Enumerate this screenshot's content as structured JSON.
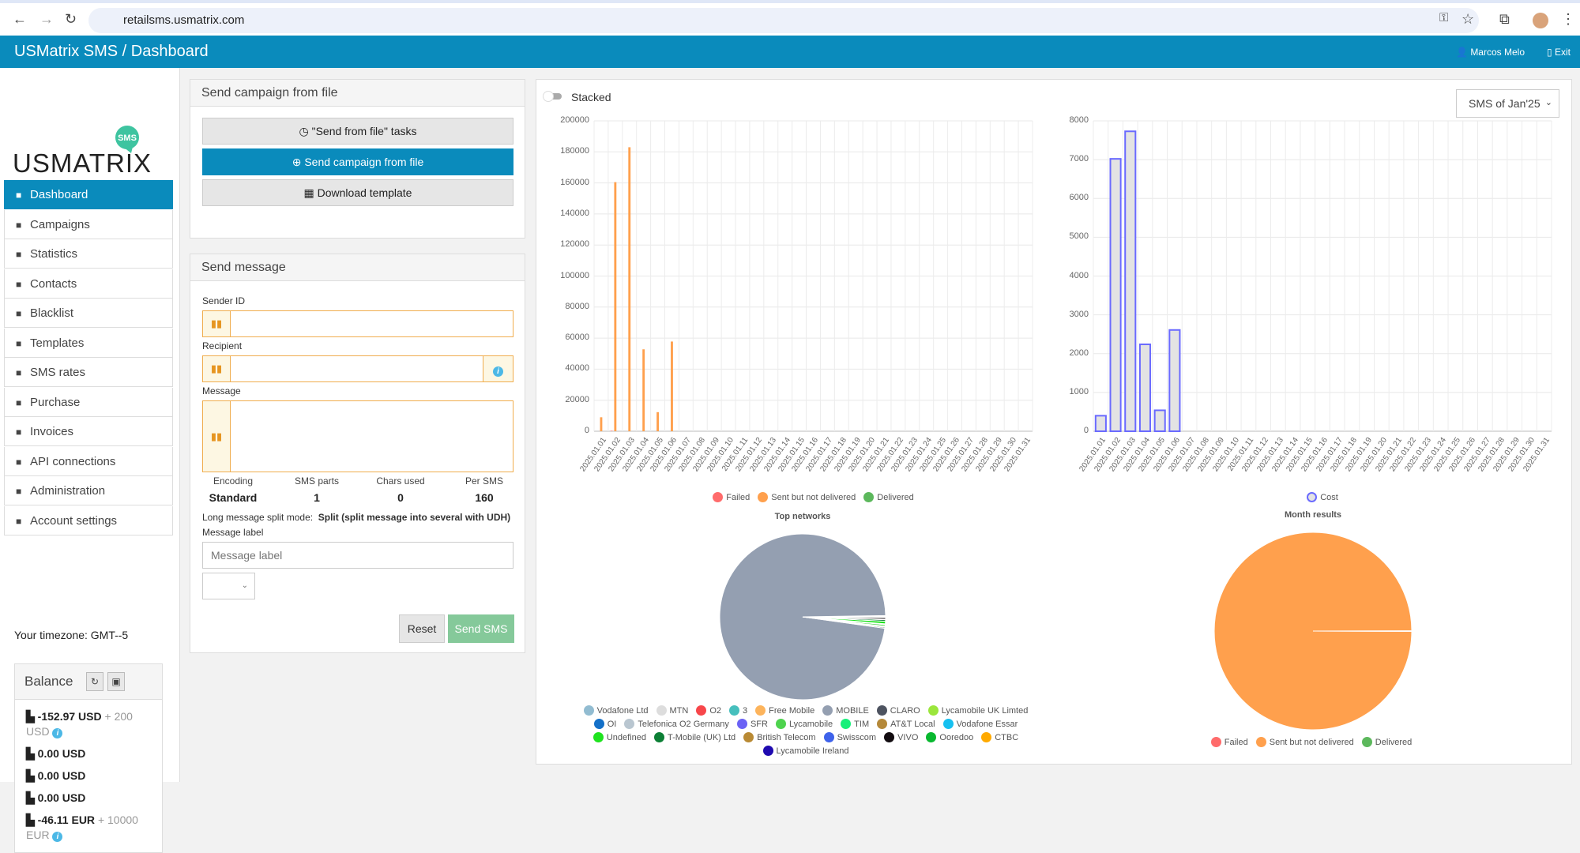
{
  "browser": {
    "url": "retailsms.usmatrix.com"
  },
  "header": {
    "title": "USMatrix SMS / Dashboard",
    "user": "Marcos Melo",
    "exit": "Exit"
  },
  "logo": {
    "text": "USMATRIX",
    "badge": "SMS"
  },
  "sidebar": {
    "items": [
      {
        "label": "Dashboard",
        "icon": "dashboard-icon",
        "active": true
      },
      {
        "label": "Campaigns",
        "icon": "comments-icon"
      },
      {
        "label": "Statistics",
        "icon": "report-icon"
      },
      {
        "label": "Contacts",
        "icon": "address-book-icon"
      },
      {
        "label": "Blacklist",
        "icon": "blacklist-icon"
      },
      {
        "label": "Templates",
        "icon": "file-icon"
      },
      {
        "label": "SMS rates",
        "icon": "rates-icon"
      },
      {
        "label": "Purchase",
        "icon": "cart-icon"
      },
      {
        "label": "Invoices",
        "icon": "invoice-icon"
      },
      {
        "label": "API connections",
        "icon": "plug-icon"
      },
      {
        "label": "Administration",
        "icon": "building-icon"
      },
      {
        "label": "Account settings",
        "icon": "gear-icon"
      }
    ],
    "timezone": "Your timezone: GMT--5"
  },
  "balance": {
    "title": "Balance",
    "rows": [
      {
        "amount": "-152.97 USD",
        "extra": "+ 200 USD",
        "info": true
      },
      {
        "amount": "0.00 USD"
      },
      {
        "amount": "0.00 USD"
      },
      {
        "amount": "0.00 USD"
      },
      {
        "amount": "-46.11 EUR",
        "extra": "+ 10000 EUR",
        "info": true
      }
    ]
  },
  "campaign_panel": {
    "title": "Send campaign from file",
    "tasks": "\"Send from file\" tasks",
    "send": "Send campaign from file",
    "download": "Download template"
  },
  "send_panel": {
    "title": "Send message",
    "sender_label": "Sender ID",
    "sender_value": "",
    "recipient_label": "Recipient",
    "recipient_value": "",
    "message_label": "Message",
    "message_value": "",
    "stats": [
      {
        "label": "Encoding",
        "value": "Standard"
      },
      {
        "label": "SMS parts",
        "value": "1"
      },
      {
        "label": "Chars used",
        "value": "0"
      },
      {
        "label": "Per SMS",
        "value": "160"
      }
    ],
    "split_label": "Long message split mode:",
    "split_value": "Split (split message into several with UDH)",
    "msglabel_label": "Message label",
    "msglabel_placeholder": "Message label",
    "select_value": "",
    "reset": "Reset",
    "send": "Send SMS"
  },
  "dashboard": {
    "stacked_label": "Stacked",
    "stacked": false,
    "period": "SMS of Jan'25"
  },
  "colors": {
    "brand": "#0a8bbc",
    "failed": "#ff6b6b",
    "sent": "#ffa04d",
    "delivered": "#5cb85c",
    "cost_border": "#6a6aff",
    "cost_fill": "#e3e3e3",
    "send_sms": "#85c99a"
  },
  "chart_data": [
    {
      "type": "bar",
      "ylim": [
        0,
        200000
      ],
      "yticks": [
        "0",
        "20000",
        "40000",
        "60000",
        "80000",
        "100000",
        "120000",
        "140000",
        "160000",
        "180000",
        "200000"
      ],
      "categories": [
        "2025.01.01",
        "2025.01.02",
        "2025.01.03",
        "2025.01.04",
        "2025.01.05",
        "2025.01.06",
        "2025.01.07",
        "2025.01.08",
        "2025.01.09",
        "2025.01.10",
        "2025.01.11",
        "2025.01.12",
        "2025.01.13",
        "2025.01.14",
        "2025.01.15",
        "2025.01.16",
        "2025.01.17",
        "2025.01.18",
        "2025.01.19",
        "2025.01.20",
        "2025.01.21",
        "2025.01.22",
        "2025.01.23",
        "2025.01.24",
        "2025.01.25",
        "2025.01.26",
        "2025.01.27",
        "2025.01.28",
        "2025.01.29",
        "2025.01.30",
        "2025.01.31"
      ],
      "series": [
        {
          "name": "Failed",
          "color": "#ff6b6b",
          "values": [
            0,
            300,
            0,
            0,
            0,
            0,
            0,
            0,
            0,
            0,
            0,
            0,
            0,
            0,
            0,
            0,
            0,
            0,
            0,
            0,
            0,
            0,
            0,
            0,
            0,
            0,
            0,
            0,
            0,
            0,
            0
          ]
        },
        {
          "name": "Sent but not delivered",
          "color": "#ffa04d",
          "values": [
            9000,
            160500,
            183000,
            52800,
            12300,
            57800,
            0,
            0,
            0,
            0,
            0,
            0,
            0,
            0,
            0,
            0,
            0,
            0,
            0,
            0,
            0,
            0,
            0,
            0,
            0,
            0,
            0,
            0,
            0,
            0,
            0
          ]
        },
        {
          "name": "Delivered",
          "color": "#5cb85c",
          "values": [
            0,
            0,
            0,
            0,
            0,
            0,
            0,
            0,
            0,
            0,
            0,
            0,
            0,
            0,
            0,
            0,
            0,
            0,
            0,
            0,
            0,
            0,
            0,
            0,
            0,
            0,
            0,
            0,
            0,
            0,
            0
          ]
        }
      ],
      "grid": true,
      "legend": "bottom"
    },
    {
      "type": "bar",
      "ylim": [
        0,
        8000
      ],
      "yticks": [
        "0",
        "1000",
        "2000",
        "3000",
        "4000",
        "5000",
        "6000",
        "7000",
        "8000"
      ],
      "series": [
        {
          "name": "Cost",
          "color": "#6a6aff",
          "values": [
            400,
            7020,
            7730,
            2240,
            540,
            2610,
            0,
            0,
            0,
            0,
            0,
            0,
            0,
            0,
            0,
            0,
            0,
            0,
            0,
            0,
            0,
            0,
            0,
            0,
            0,
            0,
            0,
            0,
            0,
            0,
            0
          ]
        }
      ],
      "grid": true,
      "legend": "bottom"
    },
    {
      "type": "pie",
      "title": "Top networks",
      "legend": "bottom",
      "slices": [
        {
          "name": "Vodafone Ltd",
          "color": "#92bcd1",
          "value": 0.05
        },
        {
          "name": "MTN",
          "color": "#dddddd",
          "value": 0.05
        },
        {
          "name": "O2",
          "color": "#f7464a",
          "value": 0.05
        },
        {
          "name": "3",
          "color": "#46bfbd",
          "value": 0.05
        },
        {
          "name": "Free Mobile",
          "color": "#fdb45c",
          "value": 0.05
        },
        {
          "name": "MOBILE",
          "color": "#949fb1",
          "value": 97.5
        },
        {
          "name": "CLARO",
          "color": "#4d5360",
          "value": 0.2
        },
        {
          "name": "Lycamobile UK Limted",
          "color": "#9be63c",
          "value": 0.05
        },
        {
          "name": "OI",
          "color": "#1470c8",
          "value": 0.05
        },
        {
          "name": "Telefonica O2 Germany",
          "color": "#b9c6d0",
          "value": 0.05
        },
        {
          "name": "SFR",
          "color": "#6b62f5",
          "value": 0.05
        },
        {
          "name": "Lycamobile",
          "color": "#4ed34e",
          "value": 0.3
        },
        {
          "name": "TIM",
          "color": "#17f07a",
          "value": 0.05
        },
        {
          "name": "AT&T Local",
          "color": "#b5893a",
          "value": 0.05
        },
        {
          "name": "Vodafone Essar",
          "color": "#16c0f0",
          "value": 0.05
        },
        {
          "name": "Undefined",
          "color": "#1fe31f",
          "value": 0.5
        },
        {
          "name": "T-Mobile (UK) Ltd",
          "color": "#0c7f35",
          "value": 0.3
        },
        {
          "name": "British Telecom",
          "color": "#b98a34",
          "value": 0.05
        },
        {
          "name": "Swisscom",
          "color": "#3e62ea",
          "value": 0.05
        },
        {
          "name": "VIVO",
          "color": "#120c10",
          "value": 0.3
        },
        {
          "name": "Ooredoo",
          "color": "#08b82f",
          "value": 0.05
        },
        {
          "name": "CTBC",
          "color": "#ffaa00",
          "value": 0.05
        },
        {
          "name": "Lycamobile Ireland",
          "color": "#1f0ab0",
          "value": 0.05
        }
      ]
    },
    {
      "type": "pie",
      "title": "Month results",
      "legend": "bottom",
      "slices": [
        {
          "name": "Failed",
          "color": "#ff6b6b",
          "value": 0.05
        },
        {
          "name": "Sent but not delivered",
          "color": "#ffa04d",
          "value": 99.9
        },
        {
          "name": "Delivered",
          "color": "#5cb85c",
          "value": 0.05
        }
      ]
    }
  ]
}
